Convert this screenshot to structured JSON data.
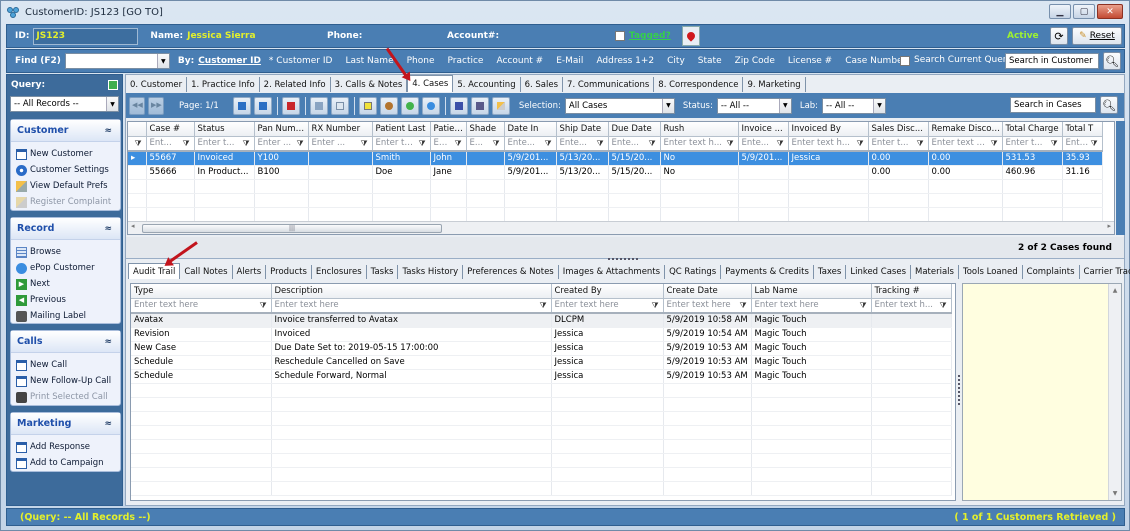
{
  "window": {
    "title": "CustomerID: JS123 [GO TO]",
    "controls": [
      "minimize",
      "maximize",
      "close"
    ]
  },
  "header": {
    "id_label": "ID:",
    "id_value": "JS123",
    "name_label": "Name:",
    "name_value": "Jessica Sierra",
    "phone_label": "Phone:",
    "phone_value": "",
    "account_label": "Account#:",
    "account_value": "",
    "tagged_label": "Tagged?",
    "tagged_checked": false,
    "status": "Active",
    "reset_label": "Reset"
  },
  "find": {
    "label": "Find (F2)",
    "value": "",
    "by_label": "By:",
    "by_selected": "Customer ID",
    "by_options": [
      "* Customer ID",
      "Last Name",
      "Phone",
      "Practice",
      "Account #",
      "E-Mail",
      "Address 1+2",
      "City",
      "State",
      "Zip Code",
      "License #",
      "Case Number"
    ],
    "search_current_query_label": "Search Current Query",
    "search_current_query_checked": false,
    "search_placeholder": "Search in Customer"
  },
  "sidebar": {
    "query_label": "Query:",
    "query_value": "-- All Records --",
    "panels": [
      {
        "title": "Customer",
        "items": [
          {
            "label": "New Customer",
            "icon": "new-doc-icon",
            "enabled": true
          },
          {
            "label": "Customer Settings",
            "icon": "settings-icon",
            "enabled": true
          },
          {
            "label": "View Default Prefs",
            "icon": "prefs-icon",
            "enabled": true
          },
          {
            "label": "Register Complaint",
            "icon": "complaint-icon",
            "enabled": false
          }
        ]
      },
      {
        "title": "Record",
        "items": [
          {
            "label": "Browse",
            "icon": "grid-icon",
            "enabled": true
          },
          {
            "label": "ePop Customer",
            "icon": "chat-icon",
            "enabled": true
          },
          {
            "label": "Next",
            "icon": "next-icon",
            "enabled": true
          },
          {
            "label": "Previous",
            "icon": "previous-icon",
            "enabled": true
          },
          {
            "label": "Mailing Label",
            "icon": "printer-icon",
            "enabled": true
          }
        ]
      },
      {
        "title": "Calls",
        "items": [
          {
            "label": "New Call",
            "icon": "new-doc-icon",
            "enabled": true
          },
          {
            "label": "New Follow-Up Call",
            "icon": "new-doc-icon",
            "enabled": true
          },
          {
            "label": "Print Selected Call",
            "icon": "printer-icon",
            "enabled": false
          }
        ]
      },
      {
        "title": "Marketing",
        "items": [
          {
            "label": "Add Response",
            "icon": "new-doc-icon",
            "enabled": true
          },
          {
            "label": "Add to Campaign",
            "icon": "new-doc-icon",
            "enabled": true
          }
        ]
      }
    ]
  },
  "main_tabs": [
    "0. Customer",
    "1. Practice Info",
    "2. Related Info",
    "3. Calls & Notes",
    "4. Cases",
    "5. Accounting",
    "6. Sales",
    "7. Communications",
    "8. Correspondence",
    "9. Marketing"
  ],
  "active_main_tab": "4. Cases",
  "cases_toolbar": {
    "page_label": "Page: 1/1",
    "selection_label": "Selection:",
    "selection_value": "All Cases",
    "status_label": "Status:",
    "status_value": "-- All --",
    "lab_label": "Lab:",
    "lab_value": "-- All --",
    "search_placeholder": "Search in Cases"
  },
  "cases_grid": {
    "columns": [
      "Case #",
      "Status",
      "Pan Number",
      "RX Number",
      "Patient Last",
      "Patient First",
      "Shade",
      "Date In",
      "Ship Date",
      "Due Date",
      "Rush",
      "Invoice ...",
      "Invoiced By",
      "Sales Disc...",
      "Remake Discount",
      "Total Charge",
      "Total T"
    ],
    "filters": [
      "Ent...",
      "Enter t...",
      "Enter ...",
      "Enter ...",
      "Enter te...",
      "Enter ...",
      "E...",
      "Ente...",
      "Ente...",
      "Ente...",
      "Enter text h...",
      "Ente...",
      "Enter text h...",
      "Enter t...",
      "Enter text h...",
      "Enter t...",
      "Enter t"
    ],
    "rows": [
      [
        "55667",
        "Invoiced",
        "Y100",
        "",
        "Smith",
        "John",
        "",
        "5/9/201...",
        "5/13/20...",
        "5/15/20...",
        "No",
        "5/9/201...",
        "Jessica",
        "0.00",
        "0.00",
        "531.53",
        "35.93"
      ],
      [
        "55666",
        "In Product...",
        "B100",
        "",
        "Doe",
        "Jane",
        "",
        "5/9/201...",
        "5/13/20...",
        "5/15/20...",
        "No",
        "",
        "",
        "0.00",
        "0.00",
        "460.96",
        "31.16"
      ]
    ],
    "selected_row": 0,
    "found_text": "2 of 2 Cases found"
  },
  "sub_tabs": [
    "Audit Trail",
    "Call Notes",
    "Alerts",
    "Products",
    "Enclosures",
    "Tasks",
    "Tasks History",
    "Preferences & Notes",
    "Images & Attachments",
    "QC Ratings",
    "Payments & Credits",
    "Taxes",
    "Linked Cases",
    "Materials",
    "Tools Loaned",
    "Complaints",
    "Carrier Tracking Info"
  ],
  "active_sub_tab": "Audit Trail",
  "audit_grid": {
    "columns": [
      "Type",
      "Description",
      "Created By",
      "Create Date",
      "Lab Name",
      "Tracking #"
    ],
    "filters": [
      "Enter text here",
      "Enter text here",
      "Enter text here",
      "Enter text here",
      "Enter text here",
      "Enter text h..."
    ],
    "rows": [
      [
        "Avatax",
        "Invoice transferred to Avatax",
        "DLCPM",
        "5/9/2019 10:58 AM",
        "Magic Touch",
        ""
      ],
      [
        "Revision",
        "Invoiced",
        "Jessica",
        "5/9/2019 10:54 AM",
        "Magic Touch",
        ""
      ],
      [
        "New Case",
        "Due Date Set to: 2019-05-15 17:00:00",
        "Jessica",
        "5/9/2019 10:53 AM",
        "Magic Touch",
        ""
      ],
      [
        "Schedule",
        "Reschedule Cancelled on Save",
        "Jessica",
        "5/9/2019 10:53 AM",
        "Magic Touch",
        ""
      ],
      [
        "Schedule",
        "Schedule  Forward, Normal",
        "Jessica",
        "5/9/2019 10:53 AM",
        "Magic Touch",
        ""
      ]
    ]
  },
  "status_bar": {
    "left": "(Query: -- All Records --)",
    "right": "( 1 of 1 Customers Retrieved )"
  },
  "colors": {
    "header_blue": "#4a7eb3",
    "highlight_yellow": "#e4f02b",
    "tagged_green": "#35d04a",
    "selection_blue": "#3d8fe0",
    "annotation_red": "#c2141c",
    "notes_bg": "#fffee0"
  }
}
